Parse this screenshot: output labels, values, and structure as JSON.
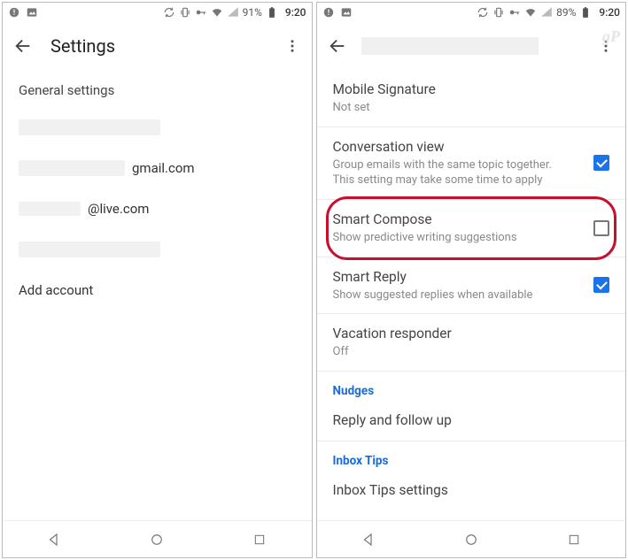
{
  "status": {
    "battery_left": "91%",
    "battery_right": "89%",
    "time": "9:20"
  },
  "left": {
    "title": "Settings",
    "section": "General settings",
    "accounts": {
      "gmail_suffix": "gmail.com",
      "live_suffix": "@live.com"
    },
    "add_account": "Add account"
  },
  "right": {
    "rows": {
      "sig": {
        "title": "Mobile Signature",
        "sub": "Not set"
      },
      "conv": {
        "title": "Conversation view",
        "sub": "Group emails with the same topic together. This setting may take some time to apply"
      },
      "smart_compose": {
        "title": "Smart Compose",
        "sub": "Show predictive writing suggestions"
      },
      "smart_reply": {
        "title": "Smart Reply",
        "sub": "Show suggested replies when available"
      },
      "vacation": {
        "title": "Vacation responder",
        "sub": "Off"
      }
    },
    "cat1": "Nudges",
    "cat1_row": "Reply and follow up",
    "cat2": "Inbox Tips",
    "cat2_row": "Inbox Tips settings"
  },
  "watermark": "gP"
}
